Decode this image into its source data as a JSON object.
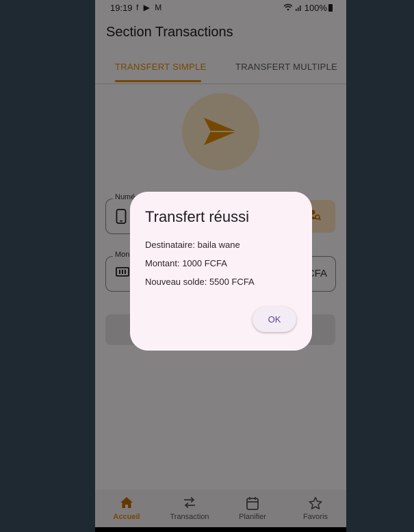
{
  "status_bar": {
    "time": "19:19",
    "notif_icons": "f ▶ M",
    "battery": "100%"
  },
  "app": {
    "title": "Section Transactions"
  },
  "tabs": [
    {
      "label": "TRANSFERT SIMPLE",
      "active": true
    },
    {
      "label": "TRANSFERT MULTIPLE",
      "active": false
    }
  ],
  "form": {
    "phone_label": "Numé",
    "amount_label": "Mon",
    "currency": "CFA"
  },
  "dialog": {
    "title": "Transfert réussi",
    "recipient": "Destinataire: baila wane",
    "amount": "Montant: 1000 FCFA",
    "balance": "Nouveau solde: 5500 FCFA",
    "ok": "OK"
  },
  "bottom_nav": [
    {
      "label": "Accueil",
      "icon": "home-icon",
      "active": true
    },
    {
      "label": "Transaction",
      "icon": "swap-icon",
      "active": false
    },
    {
      "label": "Planifier",
      "icon": "calendar-icon",
      "active": false
    },
    {
      "label": "Favoris",
      "icon": "star-icon",
      "active": false
    }
  ],
  "colors": {
    "accent": "#e08a00",
    "dialog_bg": "#fdf1f8",
    "ok_text": "#5c3f9a",
    "outer_bg": "#1f2931"
  }
}
